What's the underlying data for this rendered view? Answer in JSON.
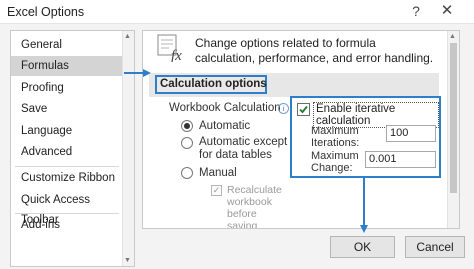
{
  "window": {
    "title": "Excel Options",
    "help_glyph": "?",
    "close_glyph": "✕"
  },
  "sidebar": {
    "items": [
      {
        "label": "General",
        "selected": false
      },
      {
        "label": "Formulas",
        "selected": true
      },
      {
        "label": "Proofing",
        "selected": false
      },
      {
        "label": "Save",
        "selected": false
      },
      {
        "label": "Language",
        "selected": false
      },
      {
        "label": "Advanced",
        "selected": false
      },
      {
        "label": "Customize Ribbon",
        "selected": false
      },
      {
        "label": "Quick Access Toolbar",
        "selected": false
      },
      {
        "label": "Add-ins",
        "selected": false
      }
    ]
  },
  "main": {
    "intro": "Change options related to formula calculation, performance, and error handling.",
    "section_title": "Calculation options",
    "workbook_calc": {
      "label": "Workbook Calculation",
      "info_glyph": "i",
      "options": [
        {
          "label": "Automatic",
          "checked": true
        },
        {
          "label": "Automatic except for data tables",
          "checked": false
        },
        {
          "label": "Manual",
          "checked": false
        }
      ],
      "recalc_label": "Recalculate workbook before saving",
      "recalc_checked": true
    },
    "iterative": {
      "checkbox_label": "Enable iterative calculation",
      "checked": true,
      "max_iterations_label": "Maximum Iterations:",
      "max_iterations_value": "100",
      "max_change_label": "Maximum Change:",
      "max_change_value": "0.001"
    }
  },
  "buttons": {
    "ok": "OK",
    "cancel": "Cancel"
  },
  "colors": {
    "accent": "#2f7ec9",
    "selected_item": "#d4d4d4"
  }
}
